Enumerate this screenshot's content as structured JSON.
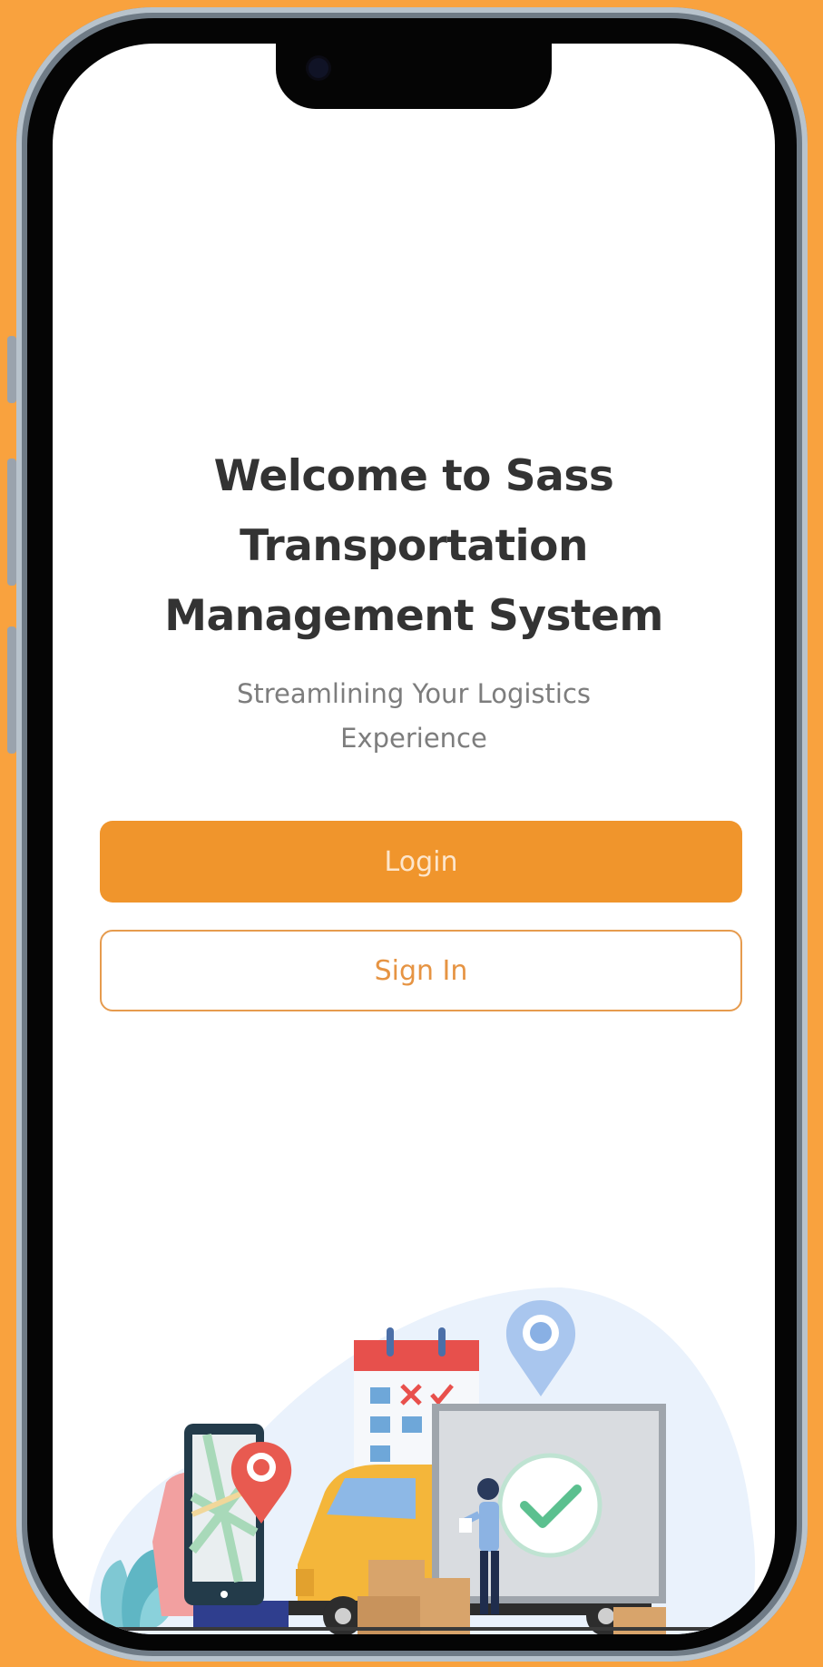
{
  "screen": {
    "title_lines": [
      "Welcome to Sass",
      "Transportation",
      "Management System"
    ],
    "subtitle_lines": [
      "Streamlining Your Logistics",
      "Experience"
    ]
  },
  "actions": {
    "login_label": "Login",
    "signin_label": "Sign In"
  },
  "colors": {
    "background": "#F9A23E",
    "accent": "#F0952C",
    "title": "#333333",
    "subtitle": "#7d7d7d"
  },
  "icons": [
    "camera-icon",
    "map-pin-icon",
    "calendar-icon",
    "check-circle-icon",
    "delivery-truck-icon",
    "phone-map-icon"
  ]
}
